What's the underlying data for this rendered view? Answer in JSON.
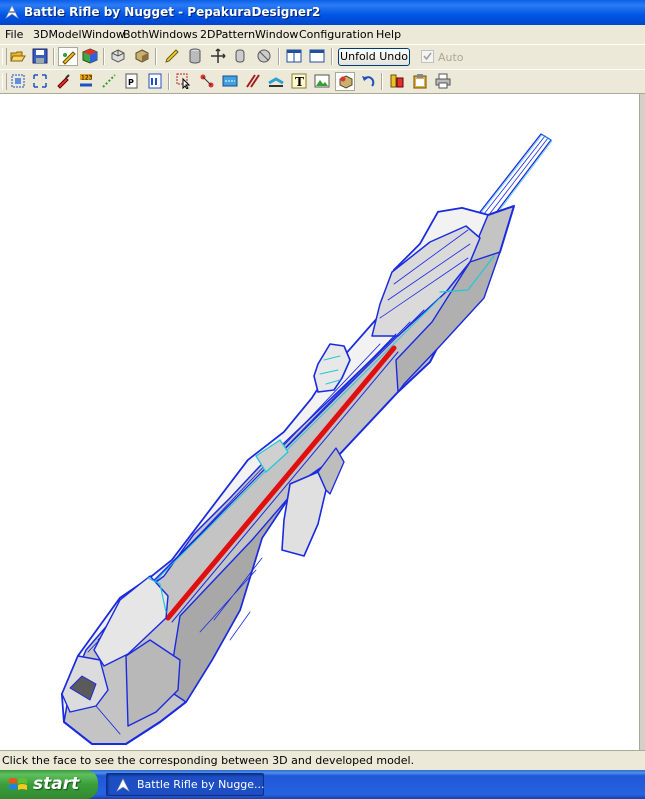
{
  "window": {
    "title": "Battle Rifle by Nugget - PepakuraDesigner2",
    "icon": "pepakura-app-icon"
  },
  "menu": [
    "File",
    "3DModelWindow",
    "BothWindows",
    "2DPatternWindow",
    "Configuration",
    "Help"
  ],
  "toolbar1": {
    "icons": [
      "open-folder-icon",
      "save-icon",
      "edit-faces-icon",
      "textured-cube-icon",
      "wireframe-box-icon",
      "shaded-box-icon",
      "pencil-icon",
      "cylinder-icon",
      "move-axes-icon",
      "rotate-view-icon",
      "spin-icon",
      "single-pane-icon",
      "split-pane-icon"
    ],
    "unfold_undo_label": "Unfold Undo",
    "auto_label": "Auto",
    "auto_checked": true
  },
  "toolbar2": {
    "icons": [
      "select-area-icon",
      "select-all-icon",
      "paint-icon",
      "number-edge-icon",
      "dotted-edge-icon",
      "page-one-icon",
      "flip-page-icon",
      "pointer-select-icon",
      "join-edge-icon",
      "flap-icon",
      "fold-lines-icon",
      "edge-style-icon",
      "text-tool-icon",
      "image-tool-icon",
      "rotate-part-icon",
      "undo-icon",
      "print-pages-icon",
      "clipboard-icon",
      "printer-icon"
    ]
  },
  "status": {
    "text": "Click the face to see the corresponding between 3D and developed model."
  },
  "taskbar": {
    "start_label": "start",
    "task_label": "Battle Rifle by Nugge..."
  },
  "colors": {
    "wire": "#1A2AE0",
    "cyan_edge": "#20C8D8",
    "highlight": "#E01010",
    "face": "#BEBEBE",
    "titlebar": "#0055E5",
    "taskbar": "#2457D8",
    "start": "#3A9E3A"
  }
}
